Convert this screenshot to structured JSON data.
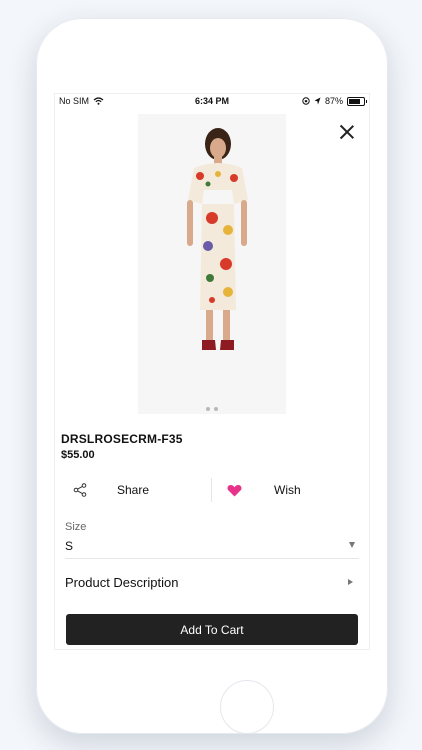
{
  "status_bar": {
    "carrier": "No SIM",
    "time": "6:34 PM",
    "battery": "87%"
  },
  "product": {
    "sku": "DRSLROSECRM-F35",
    "price": "$55.00",
    "carousel_pages": 2,
    "carousel_active": 1
  },
  "actions": {
    "share_label": "Share",
    "wish_label": "Wish",
    "wish_color": "#e8338a"
  },
  "size": {
    "label": "Size",
    "selected": "S"
  },
  "description": {
    "label": "Product Description"
  },
  "cart": {
    "button_label": "Add To Cart",
    "button_color": "#222222"
  }
}
